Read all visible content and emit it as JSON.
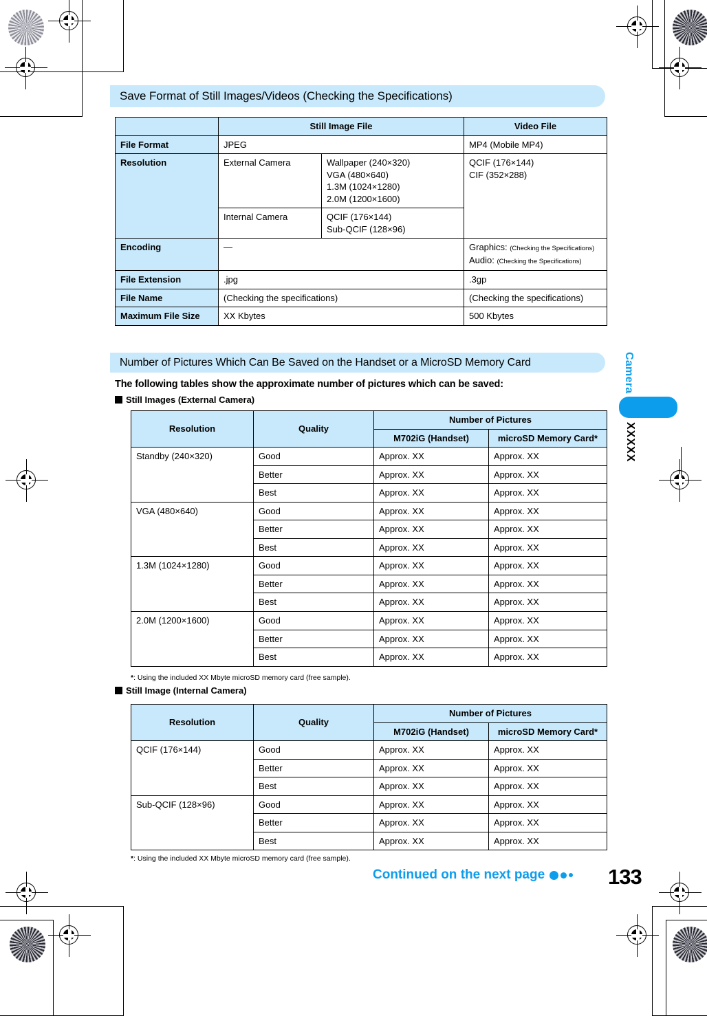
{
  "page": {
    "number": "133",
    "continued_label": "Continued on the next page",
    "side_tab_label": "Camera",
    "side_code": "XXXXX"
  },
  "section1": {
    "banner_title": "Save Format of Still Images/Videos (Checking the Specifications)",
    "table": {
      "headers": [
        "",
        "Still Image File",
        "Video File"
      ],
      "rows": [
        {
          "label": "File Format",
          "still": "JPEG",
          "video": "MP4 (Mobile MP4)"
        },
        {
          "label": "Resolution",
          "still_sub1_label": "External Camera",
          "still_sub1_values": "Wallpaper (240×320)\nVGA (480×640)\n1.3M (1024×1280)\n2.0M (1200×1600)",
          "still_sub2_label": "Internal Camera",
          "still_sub2_values": "QCIF (176×144)\nSub-QCIF (128×96)",
          "video": "QCIF (176×144)\nCIF (352×288)"
        },
        {
          "label": "Encoding",
          "still": "—",
          "video_graphics_label": "Graphics:",
          "video_graphics_value": "(Checking the Specifications)",
          "video_audio_label": "Audio:",
          "video_audio_value": "(Checking the Specifications)"
        },
        {
          "label": "File Extension",
          "still": ".jpg",
          "video": ".3gp"
        },
        {
          "label": "File Name",
          "still": "(Checking the specifications)",
          "video": "(Checking the specifications)"
        },
        {
          "label": "Maximum File Size",
          "still": "XX Kbytes",
          "video": "500 Kbytes"
        }
      ]
    }
  },
  "section2": {
    "banner_title": "Number of Pictures Which Can Be Saved on the Handset or a MicroSD Memory Card",
    "lead_text": "The following tables show the approximate number of pictures which can be saved:",
    "external": {
      "sublabel": "Still Images (External Camera)",
      "headers": {
        "resolution": "Resolution",
        "quality": "Quality",
        "group": "Number of Pictures",
        "handset": "M702iG (Handset)",
        "microsd": "microSD Memory Card*"
      },
      "groups": [
        {
          "resolution": "Standby (240×320)",
          "rows": [
            {
              "quality": "Good",
              "handset": "Approx. XX",
              "microsd": "Approx. XX"
            },
            {
              "quality": "Better",
              "handset": "Approx. XX",
              "microsd": "Approx. XX"
            },
            {
              "quality": "Best",
              "handset": "Approx. XX",
              "microsd": "Approx. XX"
            }
          ]
        },
        {
          "resolution": "VGA (480×640)",
          "rows": [
            {
              "quality": "Good",
              "handset": "Approx. XX",
              "microsd": "Approx. XX"
            },
            {
              "quality": "Better",
              "handset": "Approx. XX",
              "microsd": "Approx. XX"
            },
            {
              "quality": "Best",
              "handset": "Approx. XX",
              "microsd": "Approx. XX"
            }
          ]
        },
        {
          "resolution": "1.3M (1024×1280)",
          "rows": [
            {
              "quality": "Good",
              "handset": "Approx. XX",
              "microsd": "Approx. XX"
            },
            {
              "quality": "Better",
              "handset": "Approx. XX",
              "microsd": "Approx. XX"
            },
            {
              "quality": "Best",
              "handset": "Approx. XX",
              "microsd": "Approx. XX"
            }
          ]
        },
        {
          "resolution": "2.0M (1200×1600)",
          "rows": [
            {
              "quality": "Good",
              "handset": "Approx. XX",
              "microsd": "Approx. XX"
            },
            {
              "quality": "Better",
              "handset": "Approx. XX",
              "microsd": "Approx. XX"
            },
            {
              "quality": "Best",
              "handset": "Approx. XX",
              "microsd": "Approx. XX"
            }
          ]
        }
      ],
      "footnote_marker": "*",
      "footnote_text": ": Using the included XX Mbyte microSD memory card (free sample)."
    },
    "internal": {
      "sublabel": "Still Image (Internal Camera)",
      "headers": {
        "resolution": "Resolution",
        "quality": "Quality",
        "group": "Number of Pictures",
        "handset": "M702iG (Handset)",
        "microsd": "microSD Memory Card*"
      },
      "groups": [
        {
          "resolution": "QCIF (176×144)",
          "rows": [
            {
              "quality": "Good",
              "handset": "Approx. XX",
              "microsd": "Approx. XX"
            },
            {
              "quality": "Better",
              "handset": "Approx. XX",
              "microsd": "Approx. XX"
            },
            {
              "quality": "Best",
              "handset": "Approx. XX",
              "microsd": "Approx. XX"
            }
          ]
        },
        {
          "resolution": "Sub-QCIF (128×96)",
          "rows": [
            {
              "quality": "Good",
              "handset": "Approx. XX",
              "microsd": "Approx. XX"
            },
            {
              "quality": "Better",
              "handset": "Approx. XX",
              "microsd": "Approx. XX"
            },
            {
              "quality": "Best",
              "handset": "Approx. XX",
              "microsd": "Approx. XX"
            }
          ]
        }
      ],
      "footnote_marker": "*",
      "footnote_text": ": Using the included XX Mbyte microSD memory card (free sample)."
    }
  },
  "colors": {
    "accent_blue": "#0d9ded",
    "pale_blue": "#c8e9fb"
  }
}
